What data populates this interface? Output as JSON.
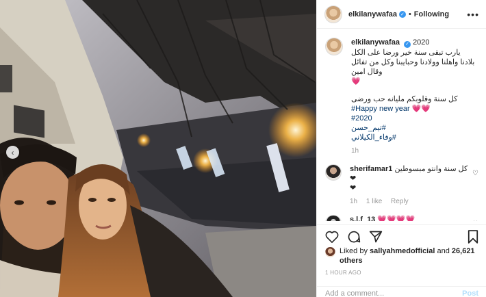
{
  "post": {
    "author": "elkilanywafaa",
    "follow_state": "Following",
    "more_glyph": "•••",
    "separator": "•"
  },
  "photo": {
    "prev_glyph": "‹"
  },
  "caption": {
    "author": "elkilanywafaa",
    "year": "2020",
    "line1": "يارب تبقى سنة خير ورضا على الكل",
    "line2": "بلادنا واهلنا وولادنا وحبايبنا وكل من تفائل وقال امين",
    "line3": "💗",
    "line4": "كل سنة وقلوبكم مليانه حب ورضى",
    "tags": [
      "#Happy new year 💗💗",
      "#2020",
      "#تيم_حسن",
      "#وفاء_الكيلاني"
    ],
    "time": "1h"
  },
  "comments": [
    {
      "author": "sherifamar1",
      "text": "كل سنة وانتو مبسوطين ❤",
      "text2": "❤",
      "time": "1h",
      "likes": "1 like",
      "reply": "Reply"
    },
    {
      "author": "s.l.f_13",
      "text": "💗💗💗💗"
    }
  ],
  "engagement": {
    "liked_prefix": "Liked by",
    "liked_user": "sallyahmedofficial",
    "and": "and",
    "others": "26,621 others",
    "timestamp": "1 HOUR AGO"
  },
  "composer": {
    "placeholder": "Add a comment...",
    "post_label": "Post"
  },
  "colors": {
    "verified": "#3897f0",
    "hashtag": "#003569",
    "border": "#efefef"
  },
  "icons": [
    "verified-icon",
    "more-icon",
    "chevron-left-icon",
    "heart-icon",
    "comment-icon",
    "share-icon",
    "bookmark-icon"
  ]
}
